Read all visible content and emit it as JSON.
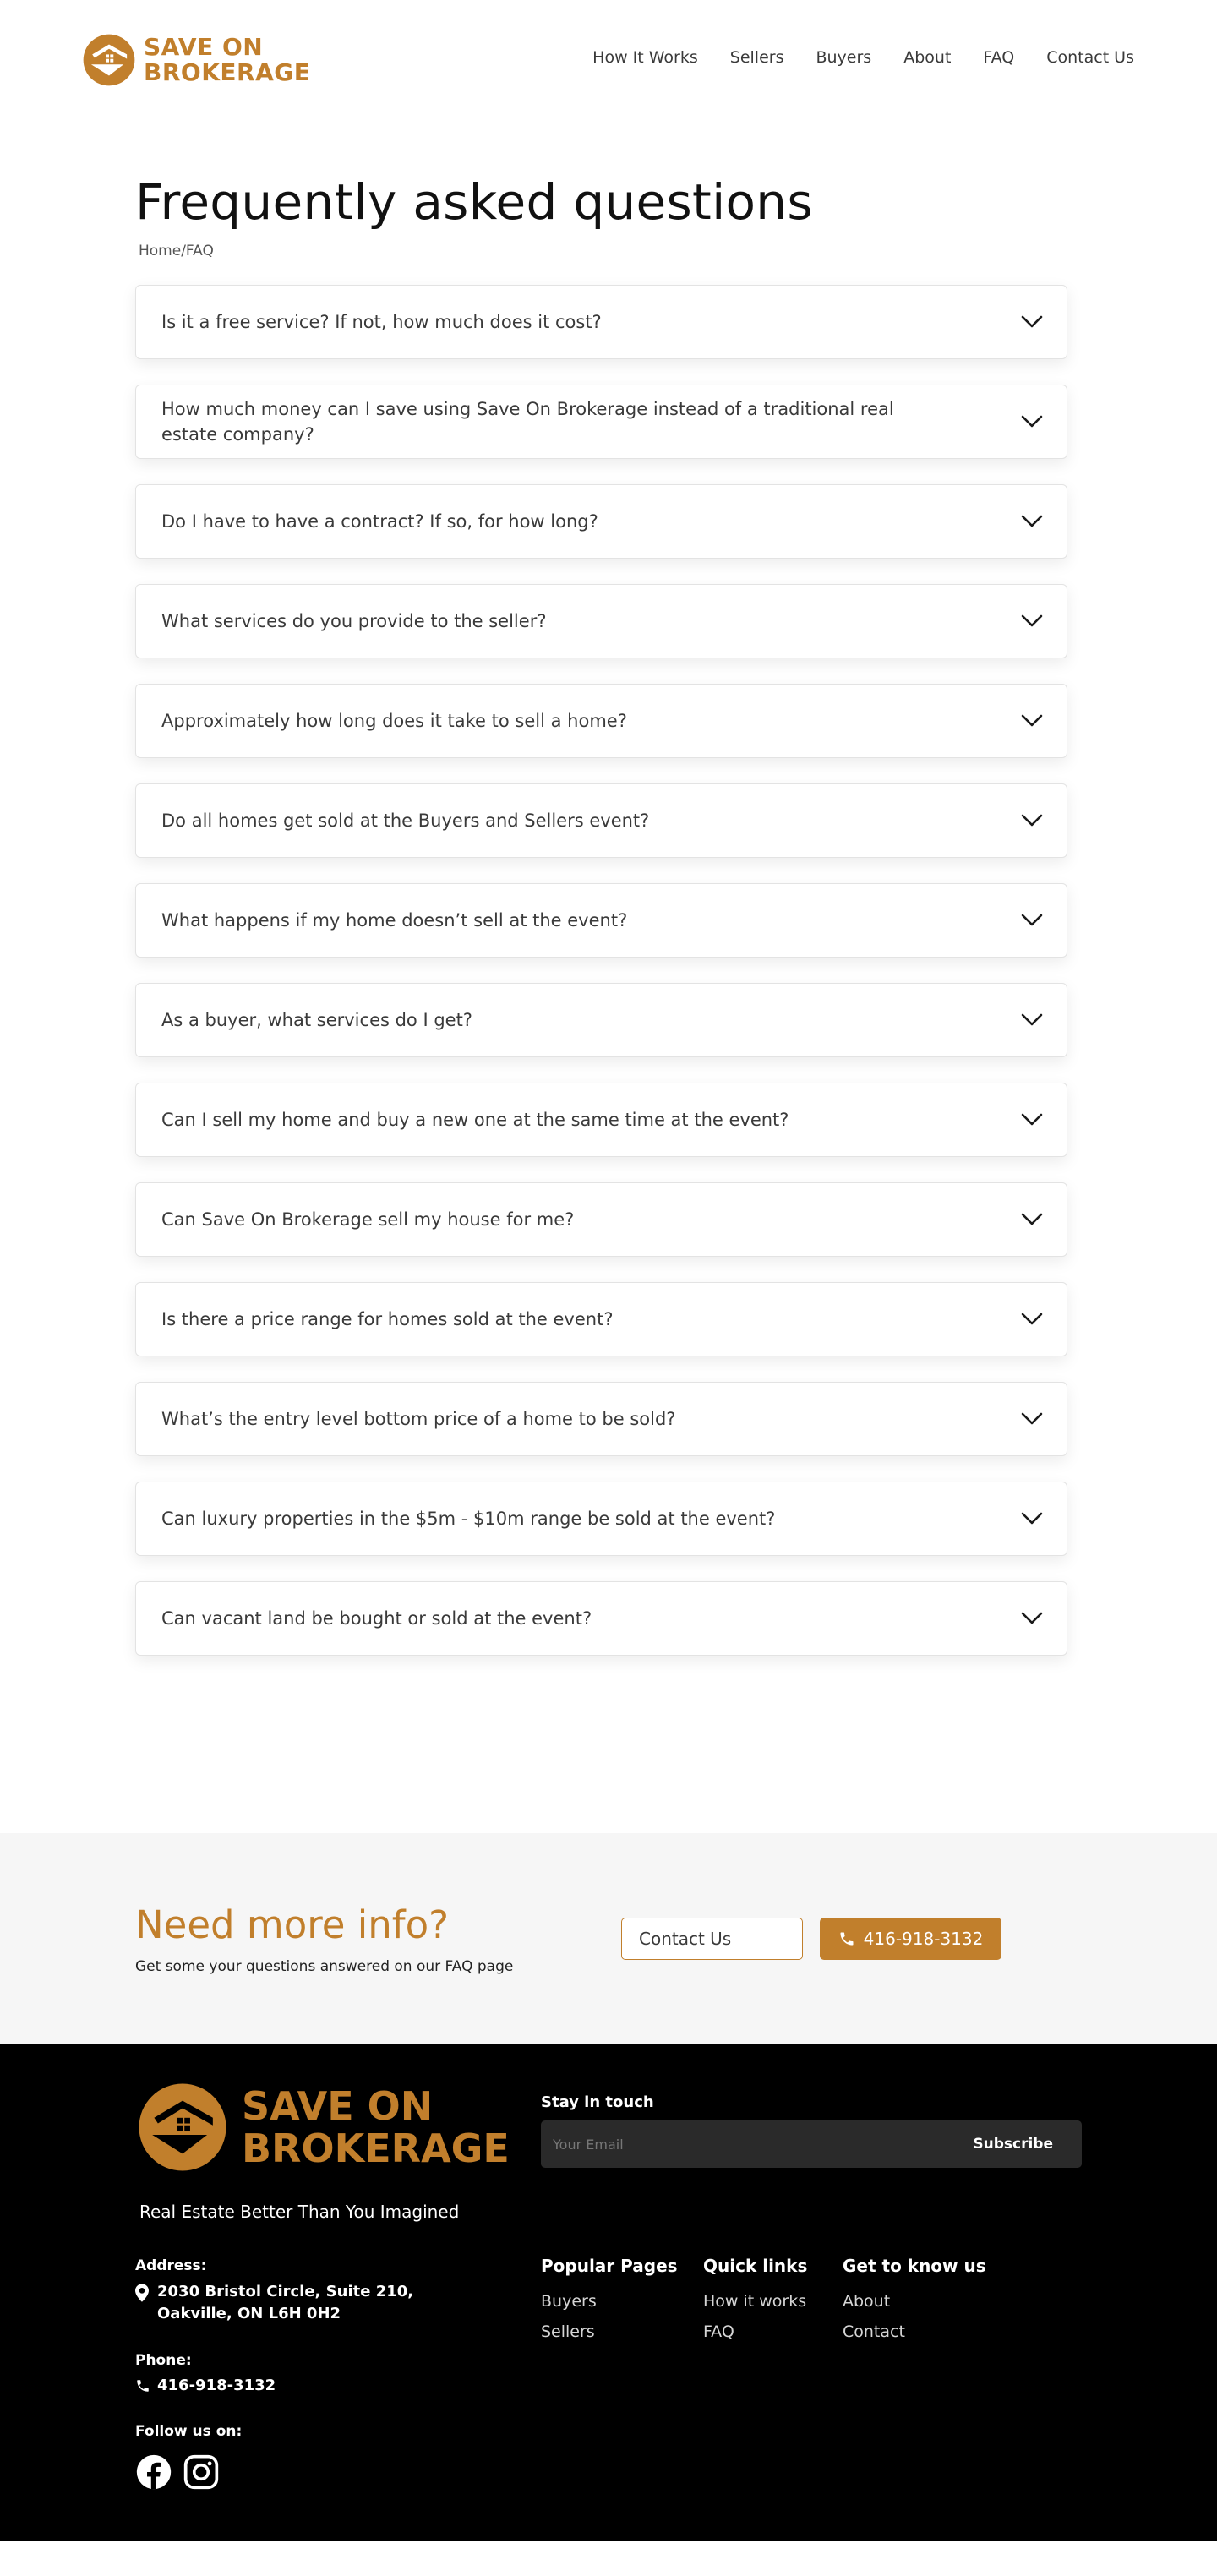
{
  "brand": {
    "name_line1": "SAVE ON",
    "name_line2": "BROKERAGE",
    "color": "#c17f2c"
  },
  "nav": {
    "items": [
      "How It Works",
      "Sellers",
      "Buyers",
      "About",
      "FAQ",
      "Contact Us"
    ]
  },
  "page": {
    "title": "Frequently asked questions",
    "breadcrumb": "Home/FAQ"
  },
  "faq": {
    "questions": [
      "Is it a free service? If not, how much does it cost?",
      "How much money can I save using Save On Brokerage instead of a traditional real estate company?",
      "Do I have to have a contract? If so, for how long?",
      "What services do you provide to the seller?",
      "Approximately how long does it take to sell a home?",
      "Do all homes get sold at the Buyers and Sellers event?",
      "What happens if my home doesn’t sell at the event?",
      "As a buyer, what services do I get?",
      "Can I sell my home and buy a new one at the same time at the event?",
      "Can Save On Brokerage sell my house for me?",
      "Is there a price range for homes sold at the event?",
      "What’s the entry level bottom price of a home to be sold?",
      "Can luxury properties in the $5m - $10m range be sold at the event?",
      "Can vacant land be bought or sold at the event?"
    ],
    "expand_icon": "chevron-down-icon"
  },
  "cta": {
    "title": "Need more info?",
    "subtitle": "Get some your questions answered on our FAQ page",
    "contact_label": "Contact Us",
    "phone_label": "416-918-3132"
  },
  "footer": {
    "tagline": "Real Estate Better Than You Imagined",
    "address_label": "Address:",
    "address_line1": "2030 Bristol Circle, Suite 210,",
    "address_line2": "Oakville, ON L6H 0H2",
    "phone_label": "Phone:",
    "phone": "416-918-3132",
    "follow_label": "Follow us on:",
    "social_icons": [
      "facebook-icon",
      "instagram-icon"
    ],
    "stay_in_touch": "Stay in touch",
    "email_placeholder": "Your Email",
    "subscribe_label": "Subscribe",
    "columns": [
      {
        "title": "Popular Pages",
        "links": [
          "Buyers",
          "Sellers"
        ]
      },
      {
        "title": "Quick links",
        "links": [
          "How it works",
          "FAQ"
        ]
      },
      {
        "title": "Get to know us",
        "links": [
          "About",
          "Contact"
        ]
      }
    ]
  }
}
